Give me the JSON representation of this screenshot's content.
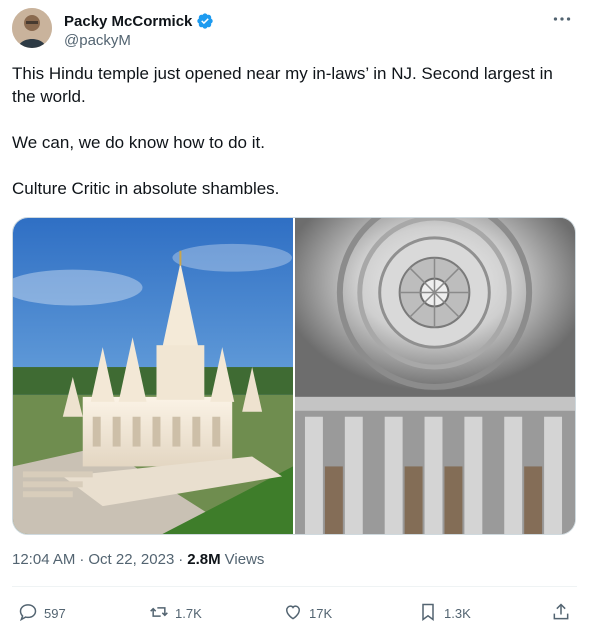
{
  "author": {
    "display_name": "Packy McCormick",
    "handle": "@packyM",
    "verified": true,
    "avatar_icon": "avatar"
  },
  "tweet": {
    "paragraphs": [
      "This Hindu temple just opened near my in-laws’ in NJ. Second largest in the world.",
      "We can, we do know how to do it.",
      "Culture Critic in absolute shambles."
    ]
  },
  "media": {
    "images": [
      {
        "icon": "temple-exterior-photo"
      },
      {
        "icon": "temple-dome-interior-photo"
      }
    ]
  },
  "meta": {
    "time": "12:04 AM",
    "separator": "·",
    "date": "Oct 22, 2023",
    "views_count": "2.8M",
    "views_label": "Views"
  },
  "actions": {
    "replies": "597",
    "reposts": "1.7K",
    "likes": "17K",
    "bookmarks": "1.3K"
  },
  "colors": {
    "text": "#0f1419",
    "secondary": "#536471",
    "verified": "#1d9bf0",
    "border": "#cfd9de"
  }
}
